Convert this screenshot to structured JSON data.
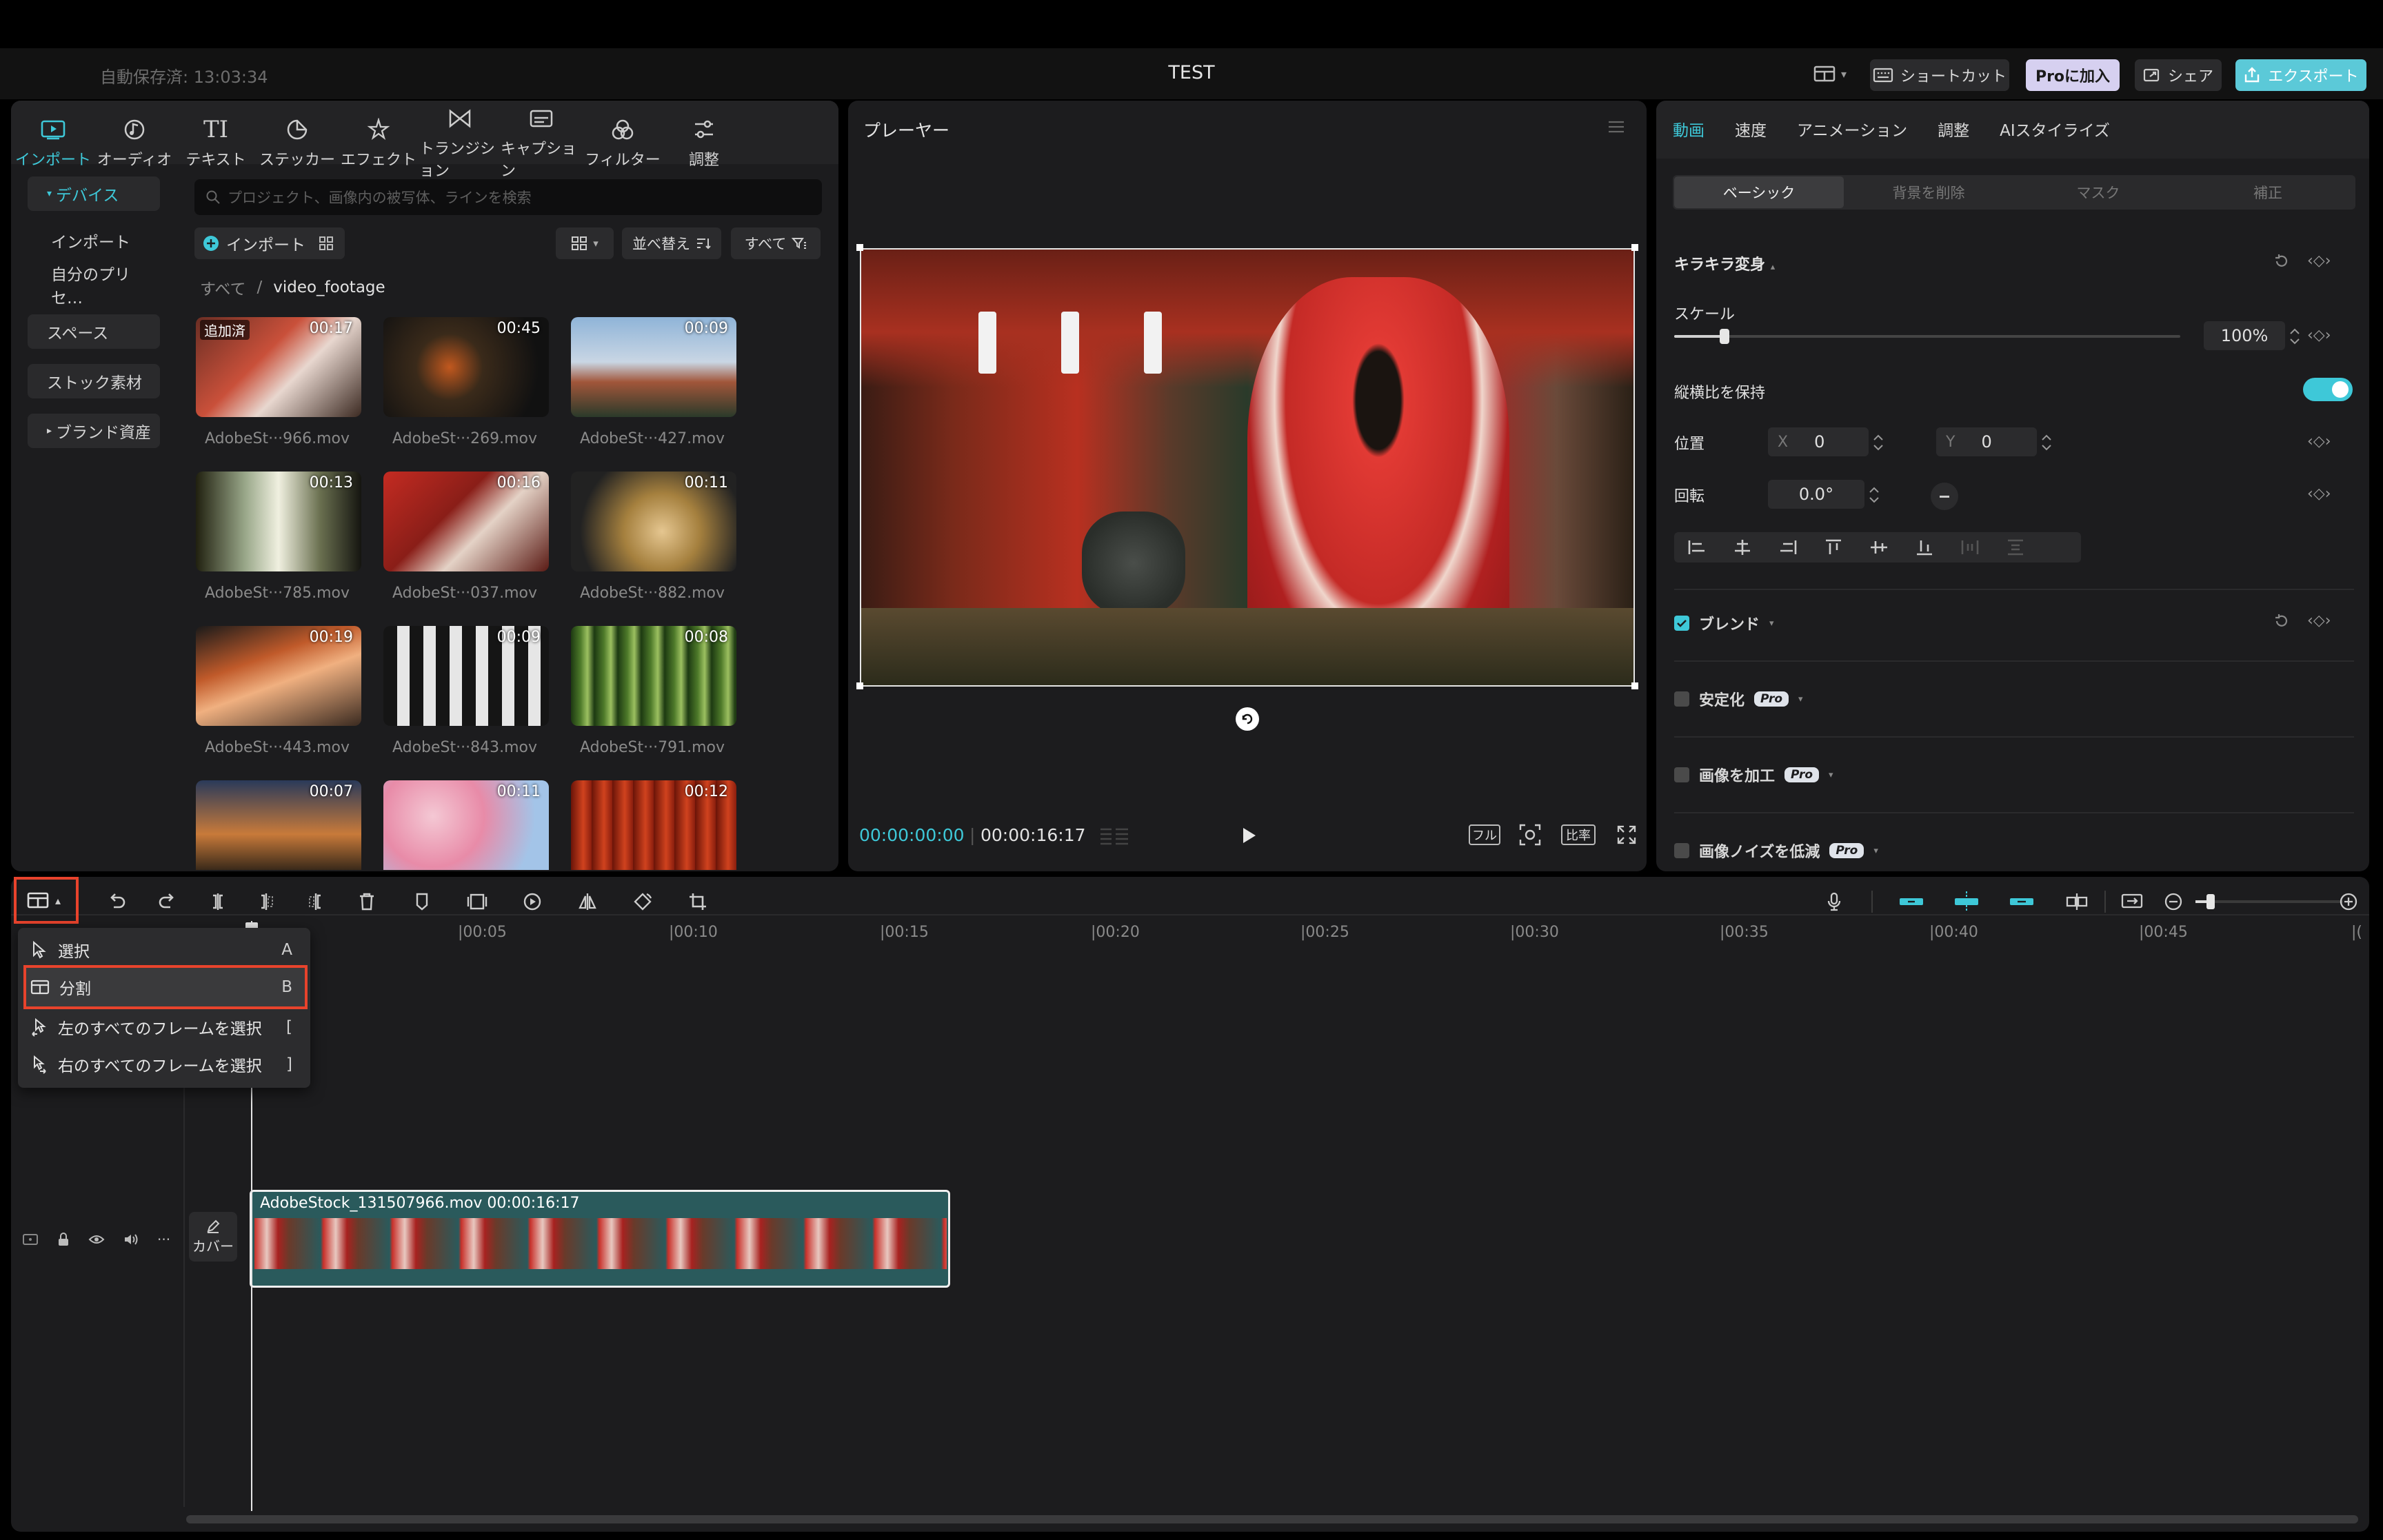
{
  "app": {
    "autosave": "自動保存済: 13:03:34",
    "project_title": "TEST",
    "shortcut_label": "ショートカット",
    "pro_label": "Proに加入",
    "share_label": "シェア",
    "export_label": "エクスポート",
    "accent": "#3ec8d8",
    "highlight_border": "#e8432c"
  },
  "media": {
    "tools": [
      {
        "label": "インポート",
        "icon": "import-icon"
      },
      {
        "label": "オーディオ",
        "icon": "audio-icon"
      },
      {
        "label": "テキスト",
        "icon": "text-icon"
      },
      {
        "label": "ステッカー",
        "icon": "sticker-icon"
      },
      {
        "label": "エフェクト",
        "icon": "effect-icon"
      },
      {
        "label": "トランジション",
        "icon": "transition-icon"
      },
      {
        "label": "キャプション",
        "icon": "caption-icon"
      },
      {
        "label": "フィルター",
        "icon": "filter-icon"
      },
      {
        "label": "調整",
        "icon": "adjust-icon"
      }
    ],
    "sidebar": [
      "デバイス",
      "インポート",
      "自分のプリセ…",
      "スペース",
      "ストック素材",
      "ブランド資産"
    ],
    "search_placeholder": "プロジェクト、画像内の被写体、ラインを検索",
    "import_button": "インポート",
    "sort_label": "並べ替え",
    "filter_label": "すべて",
    "breadcrumb_root": "すべて",
    "breadcrumb_sep": "/",
    "breadcrumb_folder": "video_footage",
    "added_badge": "追加済",
    "clips": [
      {
        "name": "AdobeSt···966.mov",
        "duration": "00:17"
      },
      {
        "name": "AdobeSt···269.mov",
        "duration": "00:45"
      },
      {
        "name": "AdobeSt···427.mov",
        "duration": "00:09"
      },
      {
        "name": "AdobeSt···785.mov",
        "duration": "00:13"
      },
      {
        "name": "AdobeSt···037.mov",
        "duration": "00:16"
      },
      {
        "name": "AdobeSt···882.mov",
        "duration": "00:11"
      },
      {
        "name": "AdobeSt···443.mov",
        "duration": "00:19"
      },
      {
        "name": "AdobeSt···843.mov",
        "duration": "00:09"
      },
      {
        "name": "AdobeSt···791.mov",
        "duration": "00:08"
      },
      {
        "name": "",
        "duration": "00:07"
      },
      {
        "name": "",
        "duration": "00:11"
      },
      {
        "name": "",
        "duration": "00:12"
      }
    ]
  },
  "player": {
    "title": "プレーヤー",
    "current_time": "00:00:00:00",
    "total_time": "00:00:16:17",
    "full_label": "フル",
    "ratio_label": "比率"
  },
  "inspector": {
    "tabs": [
      "動画",
      "速度",
      "アニメーション",
      "調整",
      "AIスタイライズ"
    ],
    "subtabs": [
      "ベーシック",
      "背景を削除",
      "マスク",
      "補正"
    ],
    "section_transform": "キラキラ変身",
    "scale_label": "スケール",
    "scale_value": "100%",
    "scale_fraction": 0.1,
    "keep_ratio_label": "縦横比を保持",
    "position_label": "位置",
    "x_label": "X",
    "x_value": "0",
    "y_label": "Y",
    "y_value": "0",
    "rotation_label": "回転",
    "rotation_value": "0.0°",
    "blend_label": "ブレンド",
    "stabilize_label": "安定化",
    "enhance_label": "画像を加工",
    "denoise_label": "画像ノイズを低減",
    "pro_badge": "Pro"
  },
  "timeline": {
    "ticks": [
      "00:05",
      "00:10",
      "00:15",
      "00:20",
      "00:25",
      "00:30",
      "00:35",
      "00:40",
      "00:45"
    ],
    "cover_label": "カバー",
    "clip_label": "AdobeStock_131507966.mov  00:00:16:17",
    "menu": [
      {
        "label": "選択",
        "key": "A",
        "icon": "cursor-icon"
      },
      {
        "label": "分割",
        "key": "B",
        "icon": "split-icon"
      },
      {
        "label": "左のすべてのフレームを選択",
        "key": "[",
        "icon": "select-left-icon"
      },
      {
        "label": "右のすべてのフレームを選択",
        "key": "]",
        "icon": "select-right-icon"
      }
    ]
  }
}
